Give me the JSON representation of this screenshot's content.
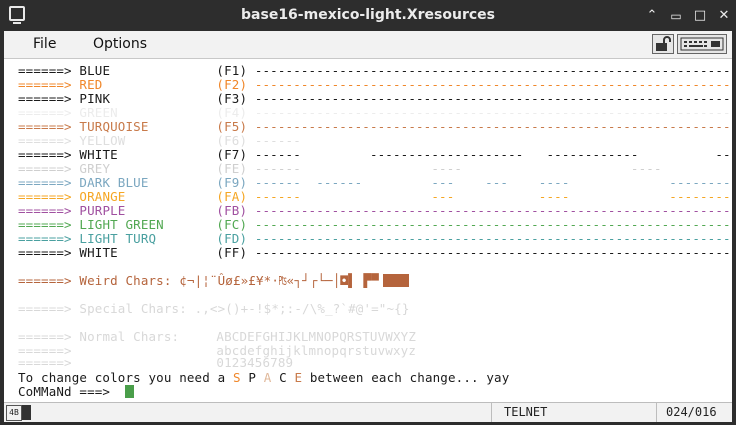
{
  "window": {
    "title": "base16-mexico-light.Xresources"
  },
  "window_buttons": {
    "minimize": "⌃",
    "restore": "□",
    "maximize": "□",
    "close": "✕"
  },
  "menu": {
    "file": "File",
    "options": "Options"
  },
  "colors": {
    "blue": "#1a1a1a",
    "red": "#f0872a",
    "pink": "#1a1a1a",
    "green": "#e8e8e8",
    "turquoise": "#c87a4a",
    "yellow": "#dedede",
    "white": "#1a1a1a",
    "grey": "#cfcfcf",
    "darkblue": "#7ba7c0",
    "orange": "#f5a623",
    "purple": "#a050a0",
    "lightgreen": "#52a852",
    "lightturq": "#4aa0a0",
    "weird": "#b5643c",
    "faint": "#d8d8d8",
    "cursor": "#4a9e4a"
  },
  "lines": [
    {
      "arrow": "======>",
      "name": "BLUE",
      "code": "(F1)",
      "dashes": "-----------------------------------------------------------------------------"
    },
    {
      "arrow": "======>",
      "name": "RED",
      "code": "(F2)",
      "dashes": "-----------------------------------------------------------------------------"
    },
    {
      "arrow": "======>",
      "name": "PINK",
      "code": "(F3)",
      "dashes": "-----------------------------------------------------------------------------"
    },
    {
      "arrow": "======>",
      "name": "GREEN",
      "code": "(F4)",
      "dashes": "-----------------------------------------------------------------------------"
    },
    {
      "arrow": "======>",
      "name": "TURQUOISE",
      "code": "(F5)",
      "dashes": "-----------------------------------------------------------------------------"
    },
    {
      "arrow": "======>",
      "name": "YELLOW",
      "code": "(F6)",
      "dashes": "------                                                                   ---"
    },
    {
      "arrow": "======>",
      "name": "WHITE",
      "code": "(F7)",
      "dashes": "------         --------------------   ------------          ----------"
    },
    {
      "arrow": "======>",
      "name": "GREY",
      "code": "(FE)",
      "dashes": "------                 ----                      ----             -------"
    },
    {
      "arrow": "======>",
      "name": "DARK BLUE",
      "code": "(F9)",
      "dashes": "------  ------         ---    ---    ----             ------------"
    },
    {
      "arrow": "======>",
      "name": "ORANGE",
      "code": "(FA)",
      "dashes": "------                 ---           ----             -----------"
    },
    {
      "arrow": "======>",
      "name": "PURPLE",
      "code": "(FB)",
      "dashes": "-----------------------------------------------------------------------------"
    },
    {
      "arrow": "======>",
      "name": "LIGHT GREEN",
      "code": "(FC)",
      "dashes": "-----------------------------------------------------------------------------"
    },
    {
      "arrow": "======>",
      "name": "LIGHT TURQ",
      "code": "(FD)",
      "dashes": "-----------------------------------------------------------------------------"
    },
    {
      "arrow": "======>",
      "name": "WHITE",
      "code": "(FF)",
      "dashes": "-----------------------------------------------------------------------------"
    }
  ],
  "weird": {
    "arrow": "======>",
    "label": "Weird Chars:",
    "chars": "¢¬|¦¨Ûø£»£¥*·₧«┐┘┌└─│◘▌ ▛▀"
  },
  "special": {
    "arrow": "======>",
    "label": "Special Chars:",
    "chars": ".,<>()+-!$*;:-/\\%_?`#@'=\"~{}"
  },
  "normal": {
    "arrow": "======>",
    "label": "Normal Chars:",
    "upper": "ABCDEFGHIJKLMNOPQRSTUVWXYZ",
    "lower": "abcdefghijklmnopqrstuvwxyz",
    "digits": "0123456789"
  },
  "hint": {
    "prefix": "To change colors you need a",
    "s": "S",
    "p": "P",
    "a": "A",
    "c": "C",
    "e": "E",
    "suffix": "between each change... yay"
  },
  "command": {
    "prompt": "CoMMaNd ===>"
  },
  "status": {
    "left_icon": "4B",
    "mode": "TELNET",
    "position": "024/016"
  }
}
